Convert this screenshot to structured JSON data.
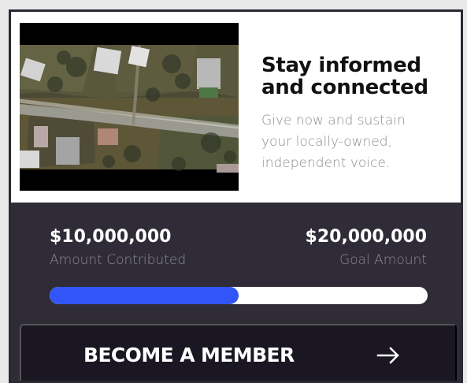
{
  "promo": {
    "title_line_1": "Stay informed",
    "title_line_2": "and connected",
    "description_line_1": "Give now and sustain",
    "description_line_2": "your locally-owned,",
    "description_line_3": "independent voice.",
    "video_icon": "aerial-village-video-thumbnail"
  },
  "stats": {
    "contributed_amount": "$10,000,000",
    "contributed_label": "Amount Contributed",
    "goal_amount": "$20,000,000",
    "goal_label": "Goal Amount",
    "progress_fraction": 0.5
  },
  "cta": {
    "label": "BECOME A MEMBER",
    "icon": "arrow-right-icon"
  },
  "colors": {
    "dark_panel": "#2f2c37",
    "button_background": "#1a1722",
    "progress_fill": "#3155f6",
    "muted_text": "#8d8d8d"
  }
}
